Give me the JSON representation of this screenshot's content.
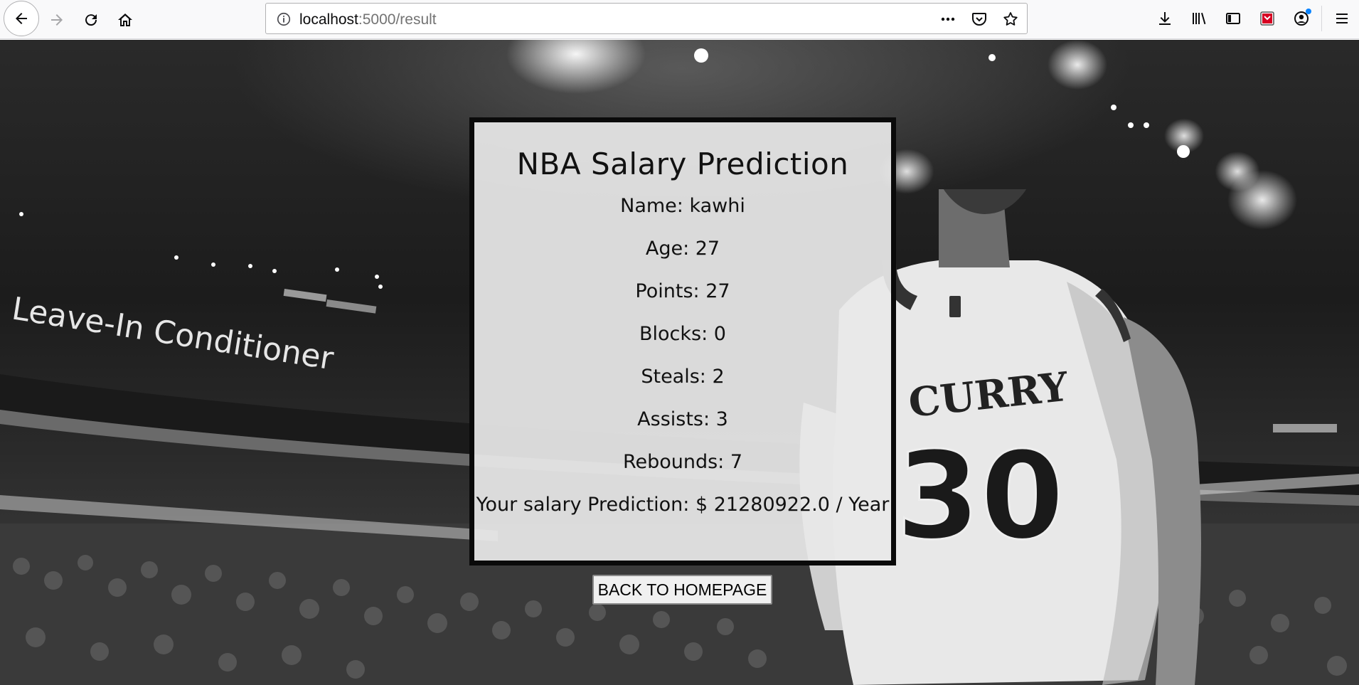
{
  "browser": {
    "url_host": "localhost",
    "url_rest": ":5000/result"
  },
  "background": {
    "arena_sign": "Leave-In Conditioner",
    "jersey_name": "CURRY",
    "jersey_number": "30"
  },
  "card": {
    "title": "NBA Salary Prediction",
    "name": "Name: kawhi",
    "age": "Age: 27",
    "points": "Points: 27",
    "blocks": "Blocks: 0",
    "steals": "Steals: 2",
    "assists": "Assists: 3",
    "rebounds": "Rebounds: 7",
    "salary": "Your salary Prediction: $ 21280922.0 / Year"
  },
  "back_button_label": "BACK TO HOMEPAGE"
}
